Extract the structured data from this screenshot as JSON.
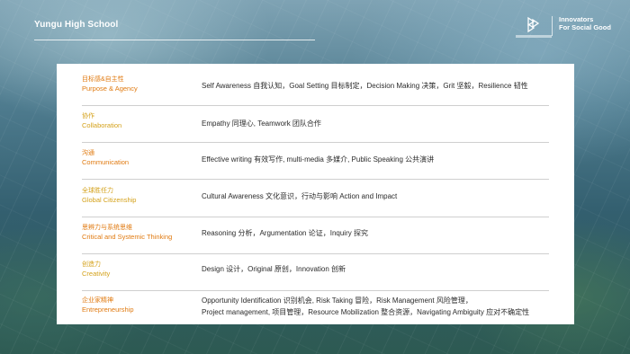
{
  "header": {
    "school": "Yungu High School",
    "brand_line1": "Innovators",
    "brand_line2": "For Social Good"
  },
  "competencies": [
    {
      "cn": "目标感&自主性",
      "en": "Purpose & Agency",
      "color": "#e07a10",
      "desc": [
        "Self Awareness 自我认知，Goal Setting 目标制定，Decision Making 决策，Grit 坚毅，Resilience 韧性"
      ]
    },
    {
      "cn": "协作",
      "en": "Collaboration",
      "color": "#d4a11a",
      "desc": [
        "Empathy 同理心, Teamwork 团队合作"
      ]
    },
    {
      "cn": "沟通",
      "en": "Communication",
      "color": "#e07a10",
      "desc": [
        "Effective writing 有效写作, multi-media 多媒介, Public Speaking 公共演讲"
      ]
    },
    {
      "cn": "全球胜任力",
      "en": "Global Citizenship",
      "color": "#d4a11a",
      "desc": [
        "Cultural Awareness 文化意识，行动与影响 Action and Impact"
      ]
    },
    {
      "cn": "思辨力与系统思维",
      "en": "Critical and Systemic Thinking",
      "color": "#e07a10",
      "desc": [
        "Reasoning 分析，Argumentation 论证，Inquiry 探究"
      ]
    },
    {
      "cn": "创造力",
      "en": "Creativity",
      "color": "#d4a11a",
      "desc": [
        "Design 设计，Original 原创，Innovation 创新"
      ]
    },
    {
      "cn": "企业家精神",
      "en": "Entrepreneurship",
      "color": "#e07a10",
      "desc": [
        "Opportunity Identification 识别机会, Risk Taking 冒险，Risk Management 风险管理，",
        "Project management, 项目管理，Resource Mobilization 整合资源，Navigating Ambiguity 应对不确定性"
      ]
    }
  ]
}
